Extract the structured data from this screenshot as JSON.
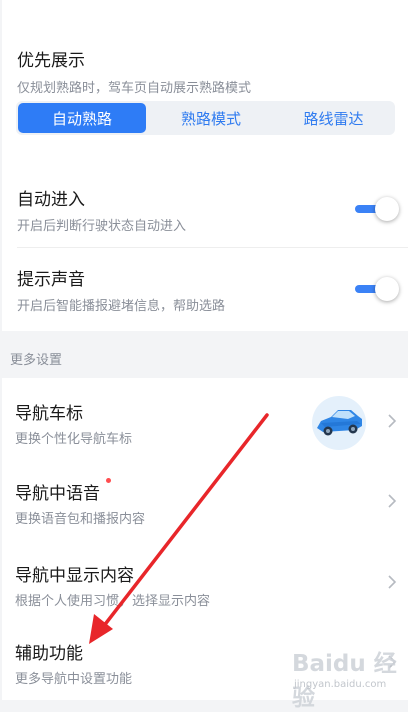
{
  "priority": {
    "title": "优先展示",
    "subtitle": "仅规划熟路时，驾车页自动展示熟路模式",
    "options": [
      "自动熟路",
      "熟路模式",
      "路线雷达"
    ],
    "selected": "自动熟路"
  },
  "auto_enter": {
    "title": "自动进入",
    "subtitle": "开启后判断行驶状态自动进入",
    "enabled": true
  },
  "voice_prompt": {
    "title": "提示声音",
    "subtitle": "开启后智能播报避堵信息，帮助选路",
    "enabled": true
  },
  "more_settings_label": "更多设置",
  "more_items": [
    {
      "title": "导航车标",
      "subtitle": "更换个性化导航车标",
      "icon": "blue-car-icon"
    },
    {
      "title": "导航中语音",
      "subtitle": "更换语音包和播报内容",
      "badge": "red-dot"
    },
    {
      "title": "导航中显示内容",
      "subtitle": "根据个人使用习惯，选择显示内容"
    },
    {
      "title": "辅助功能",
      "subtitle": "更多导航中设置功能"
    }
  ],
  "colors": {
    "accent": "#2e7cf6",
    "annotation_arrow": "#e8262a",
    "badge": "#ff4d4f"
  },
  "watermark": {
    "logo": "Baidu 经验",
    "url": "jingyan.baidu.com"
  }
}
